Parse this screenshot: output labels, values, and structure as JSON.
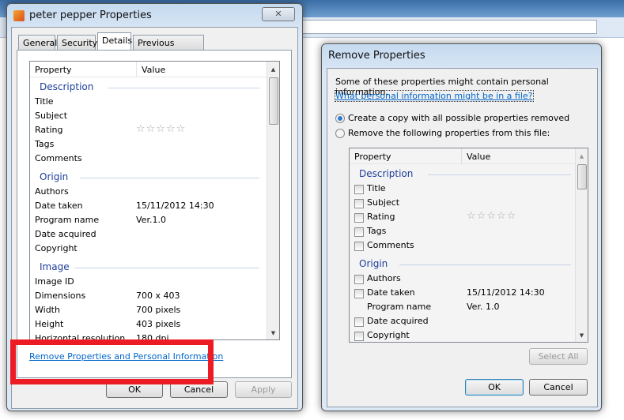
{
  "properties_dialog": {
    "title": "peter pepper Properties",
    "tabs": [
      {
        "label": "General"
      },
      {
        "label": "Security"
      },
      {
        "label": "Details",
        "active": true
      },
      {
        "label": "Previous Versions"
      }
    ],
    "list": {
      "col_property": "Property",
      "col_value": "Value",
      "groups": [
        {
          "name": "Description",
          "rows": [
            {
              "p": "Title",
              "v": ""
            },
            {
              "p": "Subject",
              "v": ""
            },
            {
              "p": "Rating",
              "v": "",
              "stars": 0
            },
            {
              "p": "Tags",
              "v": ""
            },
            {
              "p": "Comments",
              "v": ""
            }
          ]
        },
        {
          "name": "Origin",
          "rows": [
            {
              "p": "Authors",
              "v": ""
            },
            {
              "p": "Date taken",
              "v": "15/11/2012 14:30"
            },
            {
              "p": "Program name",
              "v": "Ver.1.0"
            },
            {
              "p": "Date acquired",
              "v": ""
            },
            {
              "p": "Copyright",
              "v": ""
            }
          ]
        },
        {
          "name": "Image",
          "rows": [
            {
              "p": "Image ID",
              "v": ""
            },
            {
              "p": "Dimensions",
              "v": "700 x 403"
            },
            {
              "p": "Width",
              "v": "700 pixels"
            },
            {
              "p": "Height",
              "v": "403 pixels"
            },
            {
              "p": "Horizontal resolution",
              "v": "180 dpi"
            }
          ]
        }
      ]
    },
    "remove_link": "Remove Properties and Personal Information",
    "buttons": {
      "ok": "OK",
      "cancel": "Cancel",
      "apply": "Apply"
    },
    "highlight_color": "#ed1c24"
  },
  "remove_dialog": {
    "title": "Remove Properties",
    "intro": "Some of these properties might contain personal information.",
    "help_link": "What personal information might be in a file?",
    "option_copy": "Create a copy with all possible properties removed",
    "option_remove": "Remove the following properties from this file:",
    "selected_option": "copy",
    "list": {
      "col_property": "Property",
      "col_value": "Value",
      "groups": [
        {
          "name": "Description",
          "rows": [
            {
              "p": "Title",
              "v": "",
              "cb": true
            },
            {
              "p": "Subject",
              "v": "",
              "cb": true
            },
            {
              "p": "Rating",
              "v": "",
              "cb": true,
              "stars": 0
            },
            {
              "p": "Tags",
              "v": "",
              "cb": true
            },
            {
              "p": "Comments",
              "v": "",
              "cb": true
            }
          ]
        },
        {
          "name": "Origin",
          "rows": [
            {
              "p": "Authors",
              "v": "",
              "cb": true
            },
            {
              "p": "Date taken",
              "v": "15/11/2012 14:30",
              "cb": true
            },
            {
              "p": "Program name",
              "v": "Ver. 1.0",
              "cb": false
            },
            {
              "p": "Date acquired",
              "v": "",
              "cb": true
            },
            {
              "p": "Copyright",
              "v": "",
              "cb": true
            }
          ]
        }
      ]
    },
    "buttons": {
      "select_all": "Select All",
      "ok": "OK",
      "cancel": "Cancel"
    }
  }
}
